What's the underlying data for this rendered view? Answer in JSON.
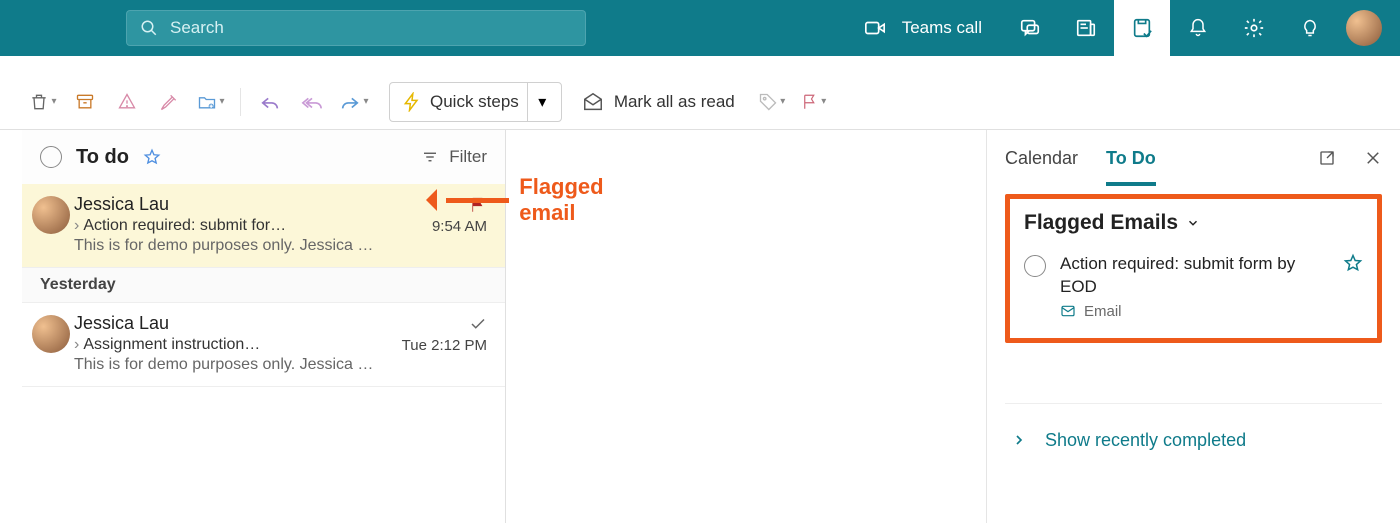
{
  "topbar": {
    "search_placeholder": "Search",
    "teams_call": "Teams call"
  },
  "cmdbar": {
    "quick_steps": "Quick steps",
    "mark_all": "Mark all as read"
  },
  "msglist": {
    "header": "To do",
    "filter": "Filter",
    "group_yesterday": "Yesterday",
    "items": [
      {
        "sender": "Jessica Lau",
        "subject": "Action required: submit for…",
        "time": "9:54 AM",
        "preview": "This is for demo purposes only. Jessica …"
      },
      {
        "sender": "Jessica Lau",
        "subject": "Assignment instruction…",
        "time": "Tue 2:12 PM",
        "preview": "This is for demo purposes only. Jessica …"
      }
    ]
  },
  "annotation": {
    "label": "Flagged email"
  },
  "sidepane": {
    "tab_calendar": "Calendar",
    "tab_todo": "To Do",
    "flagged_title": "Flagged Emails",
    "task_title": "Action required: submit form by EOD",
    "task_meta": "Email",
    "show_completed": "Show recently completed"
  }
}
